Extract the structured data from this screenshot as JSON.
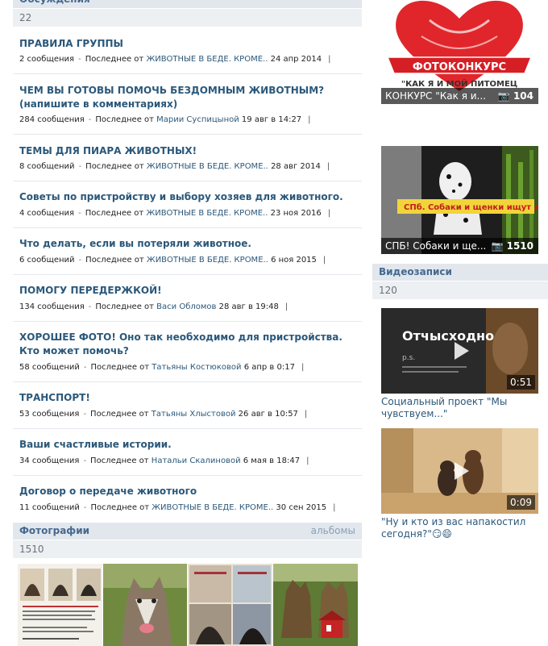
{
  "discussions": {
    "header": "Обсуждения",
    "count": "22",
    "topics": [
      {
        "title": "ПРАВИЛА ГРУППЫ",
        "count": "2 сообщения",
        "last_label": "Последнее от",
        "author": "ЖИВОТНЫЕ В БЕДЕ. КРОМЕ..",
        "date": "24 апр 2014"
      },
      {
        "title": "ЧЕМ ВЫ ГОТОВЫ ПОМОЧЬ БЕЗДОМНЫМ ЖИВОТНЫМ? (напишите в комментариях)",
        "count": "284 сообщения",
        "last_label": "Последнее от",
        "author": "Марии Суспицыной",
        "date": "19 авг в 14:27"
      },
      {
        "title": "ТЕМЫ ДЛЯ ПИАРА ЖИВОТНЫХ!",
        "count": "8 сообщений",
        "last_label": "Последнее от",
        "author": "ЖИВОТНЫЕ В БЕДЕ. КРОМЕ..",
        "date": "28 авг 2014"
      },
      {
        "title": "Советы по пристройству и выбору хозяев для животного.",
        "count": "4 сообщения",
        "last_label": "Последнее от",
        "author": "ЖИВОТНЫЕ В БЕДЕ. КРОМЕ..",
        "date": "23 ноя 2016"
      },
      {
        "title": "Что делать, если вы потеряли животное.",
        "count": "6 сообщений",
        "last_label": "Последнее от",
        "author": "ЖИВОТНЫЕ В БЕДЕ. КРОМЕ..",
        "date": "6 ноя 2015"
      },
      {
        "title": "ПОМОГУ ПЕРЕДЕРЖКОЙ!",
        "count": "134 сообщения",
        "last_label": "Последнее от",
        "author": "Васи Обломов",
        "date": "28 авг в 19:48"
      },
      {
        "title": "ХОРОШЕЕ ФОТО! Оно так необходимо для пристройства. Кто может помочь?",
        "count": "58 сообщений",
        "last_label": "Последнее от",
        "author": "Татьяны Костюковой",
        "date": "6 апр в 0:17"
      },
      {
        "title": "ТРАНСПОРТ!",
        "count": "53 сообщения",
        "last_label": "Последнее от",
        "author": "Татьяны Хлыстовой",
        "date": "26 авг в 10:57"
      },
      {
        "title": "Ваши счастливые истории.",
        "count": "34 сообщения",
        "last_label": "Последнее от",
        "author": "Натальи Скалиновой",
        "date": "6 мая в 18:47"
      },
      {
        "title": "Договор о передаче животного",
        "count": "11 сообщений",
        "last_label": "Последнее от",
        "author": "ЖИВОТНЫЕ В БЕДЕ. КРОМЕ..",
        "date": "30 сен 2015"
      }
    ]
  },
  "photos": {
    "header": "Фотографии",
    "albums_link": "альбомы",
    "count": "1510"
  },
  "albums": [
    {
      "name": "КОНКУРС \"Как я и...",
      "count": "104",
      "banner": "ФОТОКОНКУРС",
      "subtitle": "\"КАК Я И МОЙ ПИТОМЕЦ"
    },
    {
      "name": "СПБ! Собаки и ще...",
      "count": "1510",
      "banner": "СПб. Собаки и щенки ищут дом."
    }
  ],
  "videos": {
    "header": "Видеозаписи",
    "count": "120",
    "items": [
      {
        "title": "Социальный проект \"Мы чувствуем...\"",
        "duration": "0:51",
        "overlay": "Отчысходно"
      },
      {
        "title": "\"Ну и кто из вас напакостил сегодня?\"😏😄",
        "duration": "0:09"
      }
    ]
  },
  "colors": {
    "link": "#2b587a",
    "header_bg": "#e1e7ed",
    "count_bg": "#edf0f3",
    "heart": "#e0262b"
  }
}
